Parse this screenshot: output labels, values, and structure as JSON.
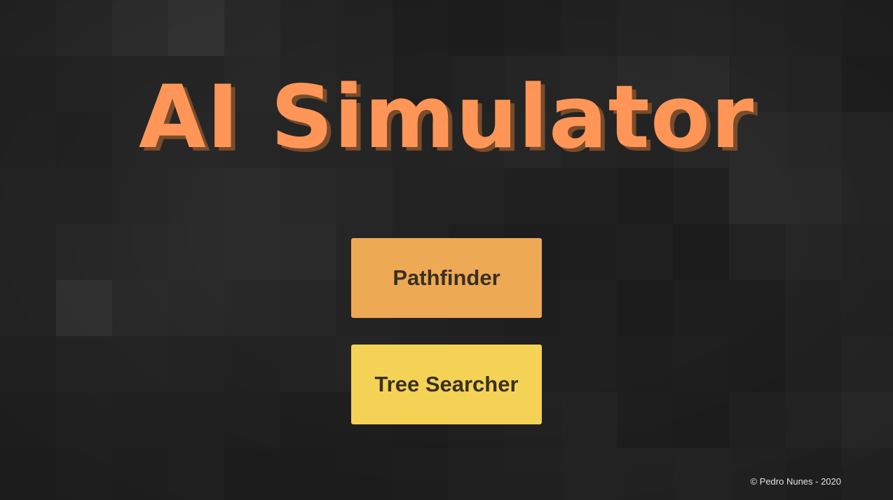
{
  "app": {
    "title": "AI Simulator"
  },
  "menu": {
    "buttons": [
      {
        "label": "Pathfinder",
        "color": "#eea954"
      },
      {
        "label": "Tree Searcher",
        "color": "#f4d255"
      }
    ]
  },
  "footer": {
    "copyright": "© Pedro Nunes - 2020"
  },
  "colors": {
    "title": "#ff9657",
    "title_shadow": "#7a4c2b",
    "button_text": "#3a3020",
    "background": "#232323"
  }
}
